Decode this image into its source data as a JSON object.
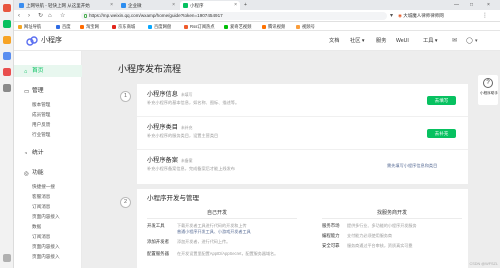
{
  "browser": {
    "tabs": [
      {
        "label": "上网导航 - 轻快上网 从这里开始"
      },
      {
        "label": "企业微"
      },
      {
        "label": "小程序"
      }
    ],
    "url": "https://mp.weixin.qq.com/wxamp/home/guide?token=1907454917",
    "right_search": "大城魔人律师律师网",
    "bookmarks": [
      {
        "label": "网址导航",
        "color": "#f5a623"
      },
      {
        "label": "百度",
        "color": "#2f6be3"
      },
      {
        "label": "淘宝网",
        "color": "#ff6a00"
      },
      {
        "label": "京东商城",
        "color": "#e1251b"
      },
      {
        "label": "百度网盘",
        "color": "#06a7ff"
      },
      {
        "label": "Rss订阅热点",
        "color": "#ef5b2b"
      },
      {
        "label": "爱奇艺视频",
        "color": "#00be06"
      },
      {
        "label": "腾讯视频",
        "color": "#ff7200"
      },
      {
        "label": "视频号",
        "color": "#fa9d3b"
      }
    ]
  },
  "site": {
    "brand": "小程序",
    "nav": [
      "文档",
      "社区",
      "服务",
      "WeUI",
      "工具"
    ]
  },
  "sidebar": {
    "home": "首页",
    "manage": "管理",
    "manage_items": [
      "版本管理",
      "成员管理",
      "用户反馈",
      "行业管理"
    ],
    "stats": "统计",
    "features": "功能",
    "feature_items": [
      "快捷搜一搜",
      "客服消息",
      "订阅消息",
      "页面内容接入",
      "数据",
      "订阅消息",
      "页面内容接入",
      "页面内容接入"
    ]
  },
  "main": {
    "title": "小程序发布流程",
    "step1": {
      "num": "1",
      "rows": [
        {
          "title": "小程序信息",
          "tag": "未填写",
          "desc": "补充小程序的基本信息，如名称、图标、描述等。",
          "button": "去填写"
        },
        {
          "title": "小程序类目",
          "tag": "未补充",
          "desc": "补充小程序的服务类目，设置主营类目",
          "button": "去补充"
        },
        {
          "title": "小程序备案",
          "tag": "未备案",
          "desc": "补充小程序备案信息，完成备案后才能上线发布",
          "link": "需先填写小程序信息和类目"
        }
      ]
    },
    "step2": {
      "num": "2",
      "title": "小程序开发与管理",
      "left_heading": "自己开发",
      "right_heading": "找服务商开发",
      "left_rows": [
        {
          "label": "开发工具",
          "text": "下载开发者工具进行代码的开发和上传",
          "link": "普通小程序开发工具、小游戏开发者工具"
        },
        {
          "label": "添加开发者",
          "text": "添加开发者，进行代码上传。"
        },
        {
          "label": "配置服务器",
          "text": "在开发设置里配置AppID/AppSecret，配置服务器域名。"
        }
      ],
      "right_rows": [
        {
          "label": "服务市场",
          "text": "提供多行业、多功能的小程序开发服务"
        },
        {
          "label": "编程能力",
          "text": "支付能力必须使用服务商"
        },
        {
          "label": "安全可靠",
          "text": "服务商通过平台审核，资质真实可靠"
        }
      ]
    }
  },
  "float": {
    "label": "小程序助手"
  },
  "watermark": "CSDN @WFSZL"
}
